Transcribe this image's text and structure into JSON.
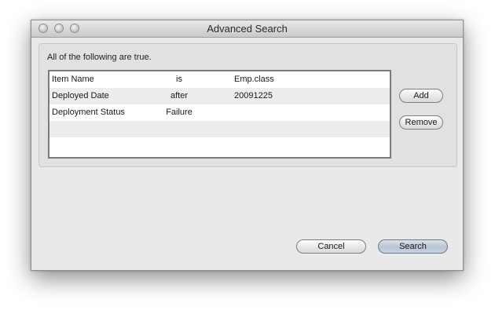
{
  "window": {
    "title": "Advanced Search"
  },
  "criteria": {
    "heading": "All of the following are true.",
    "rows": [
      {
        "field": "Item Name",
        "operator": "is",
        "value": "Emp.class"
      },
      {
        "field": "Deployed Date",
        "operator": "after",
        "value": "20091225"
      },
      {
        "field": "Deployment Status",
        "operator": "Failure",
        "value": ""
      },
      {
        "field": "",
        "operator": "",
        "value": ""
      },
      {
        "field": "",
        "operator": "",
        "value": ""
      }
    ]
  },
  "buttons": {
    "add": "Add",
    "remove": "Remove",
    "cancel": "Cancel",
    "search": "Search"
  }
}
